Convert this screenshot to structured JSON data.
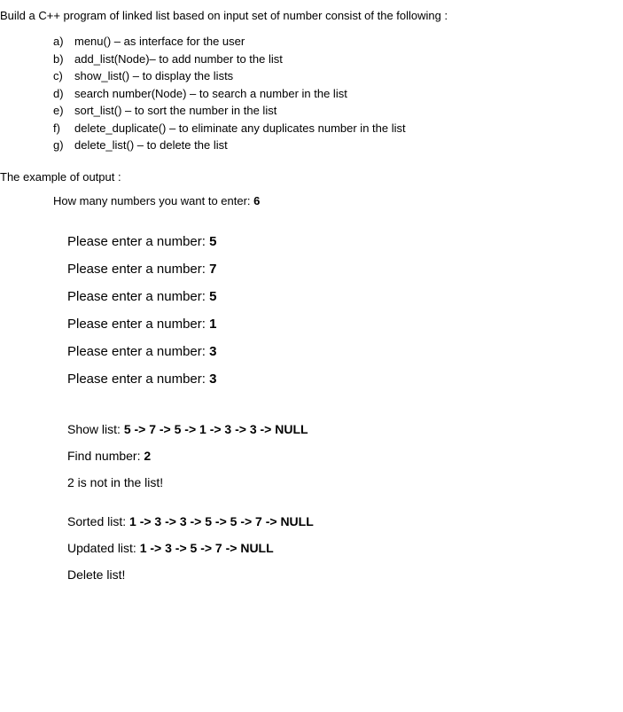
{
  "intro": "Build a C++ program of linked list based on input set of number consist of the following :",
  "items": [
    {
      "letter": "a)",
      "text": "menu() – as interface for the user"
    },
    {
      "letter": "b)",
      "text": "add_list(Node)– to add number to the list"
    },
    {
      "letter": "c)",
      "text": "show_list() – to display the lists"
    },
    {
      "letter": "d)",
      "text": "search number(Node) – to search a number in the list"
    },
    {
      "letter": "e)",
      "text": "sort_list() – to sort the number in the list"
    },
    {
      "letter": "f)",
      "text": "delete_duplicate() – to eliminate any duplicates number in the list"
    },
    {
      "letter": "g)",
      "text": "delete_list() – to delete the list"
    }
  ],
  "exampleHeader": "The example of output :",
  "howManyLabel": "How many numbers you want to enter: ",
  "howManyValue": "6",
  "enterPrompts": [
    {
      "label": "Please enter a number: ",
      "value": "5"
    },
    {
      "label": "Please enter a number: ",
      "value": "7"
    },
    {
      "label": "Please enter a number: ",
      "value": "5"
    },
    {
      "label": "Please enter a number: ",
      "value": "1"
    },
    {
      "label": "Please enter a number: ",
      "value": "3"
    },
    {
      "label": "Please enter a number: ",
      "value": "3"
    }
  ],
  "showListLabel": "Show list: ",
  "showListValue": "5 -> 7 -> 5 -> 1 -> 3 -> 3 -> NULL",
  "findLabel": "Find number: ",
  "findValue": "2",
  "findResult": "2 is not in the list!",
  "sortedLabel": "Sorted list: ",
  "sortedValue": "1 -> 3 -> 3 -> 5 -> 5 -> 7 -> NULL",
  "updatedLabel": "Updated list: ",
  "updatedValue": "1 -> 3 -> 5 -> 7 -> NULL",
  "deleteList": "Delete list!"
}
